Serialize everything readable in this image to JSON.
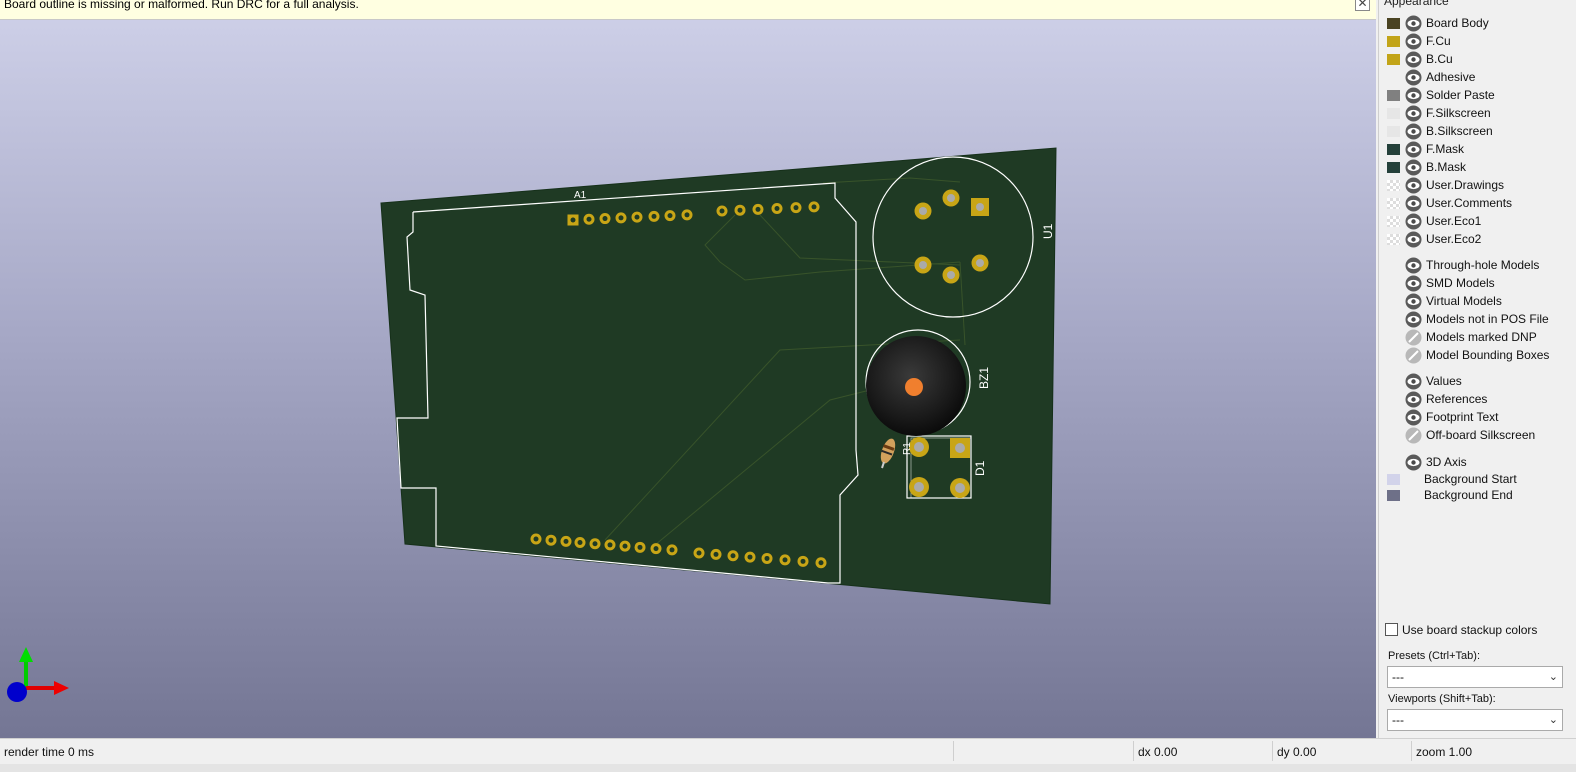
{
  "warning": {
    "message": "Board outline is missing or malformed. Run DRC for a full analysis.",
    "close_glyph": "✕"
  },
  "board": {
    "refs": {
      "a1": "A1",
      "u1": "U1",
      "bz1": "BZ1",
      "r1": "R1",
      "d1": "D1"
    },
    "colors": {
      "soldermask": "#1f3a24",
      "pad": "#c8a516",
      "silkscreen": "#ffffff",
      "buzzer_center": "#f07f2e"
    }
  },
  "panel": {
    "title": "Appearance",
    "layers": [
      {
        "label": "Board Body",
        "color": "#4a4322",
        "visible": true
      },
      {
        "label": "F.Cu",
        "color": "#c2a418",
        "visible": true
      },
      {
        "label": "B.Cu",
        "color": "#c2a418",
        "visible": true
      },
      {
        "label": "Adhesive",
        "color": "",
        "visible": true
      },
      {
        "label": "Solder Paste",
        "color": "#808080",
        "visible": true
      },
      {
        "label": "F.Silkscreen",
        "color": "#e6e6e6",
        "visible": true
      },
      {
        "label": "B.Silkscreen",
        "color": "#e6e6e6",
        "visible": true
      },
      {
        "label": "F.Mask",
        "color": "#24403a",
        "visible": true
      },
      {
        "label": "B.Mask",
        "color": "#24403a",
        "visible": true
      },
      {
        "label": "User.Drawings",
        "color": "checker",
        "visible": true
      },
      {
        "label": "User.Comments",
        "color": "checker",
        "visible": true
      },
      {
        "label": "User.Eco1",
        "color": "checker",
        "visible": true
      },
      {
        "label": "User.Eco2",
        "color": "checker",
        "visible": true
      }
    ],
    "models": [
      {
        "label": "Through-hole Models",
        "visible": true
      },
      {
        "label": "SMD Models",
        "visible": true
      },
      {
        "label": "Virtual Models",
        "visible": true
      },
      {
        "label": "Models not in POS File",
        "visible": true
      },
      {
        "label": "Models marked DNP",
        "visible": false
      },
      {
        "label": "Model Bounding Boxes",
        "visible": false
      }
    ],
    "text_items": [
      {
        "label": "Values",
        "visible": true
      },
      {
        "label": "References",
        "visible": true
      },
      {
        "label": "Footprint Text",
        "visible": true
      },
      {
        "label": "Off-board Silkscreen",
        "visible": false
      }
    ],
    "axis": {
      "label": "3D Axis",
      "visible": true
    },
    "backgrounds": [
      {
        "label": "Background Start",
        "color": "#d2d3ea"
      },
      {
        "label": "Background End",
        "color": "#6e7088"
      }
    ],
    "use_stackup_label": "Use board stackup colors",
    "presets_label": "Presets (Ctrl+Tab):",
    "presets_value": "---",
    "viewports_label": "Viewports (Shift+Tab):",
    "viewports_value": "---"
  },
  "status": {
    "render_time": "render time 0 ms",
    "dx": "dx 0.00",
    "dy": "dy 0.00",
    "zoom": "zoom 1.00"
  }
}
